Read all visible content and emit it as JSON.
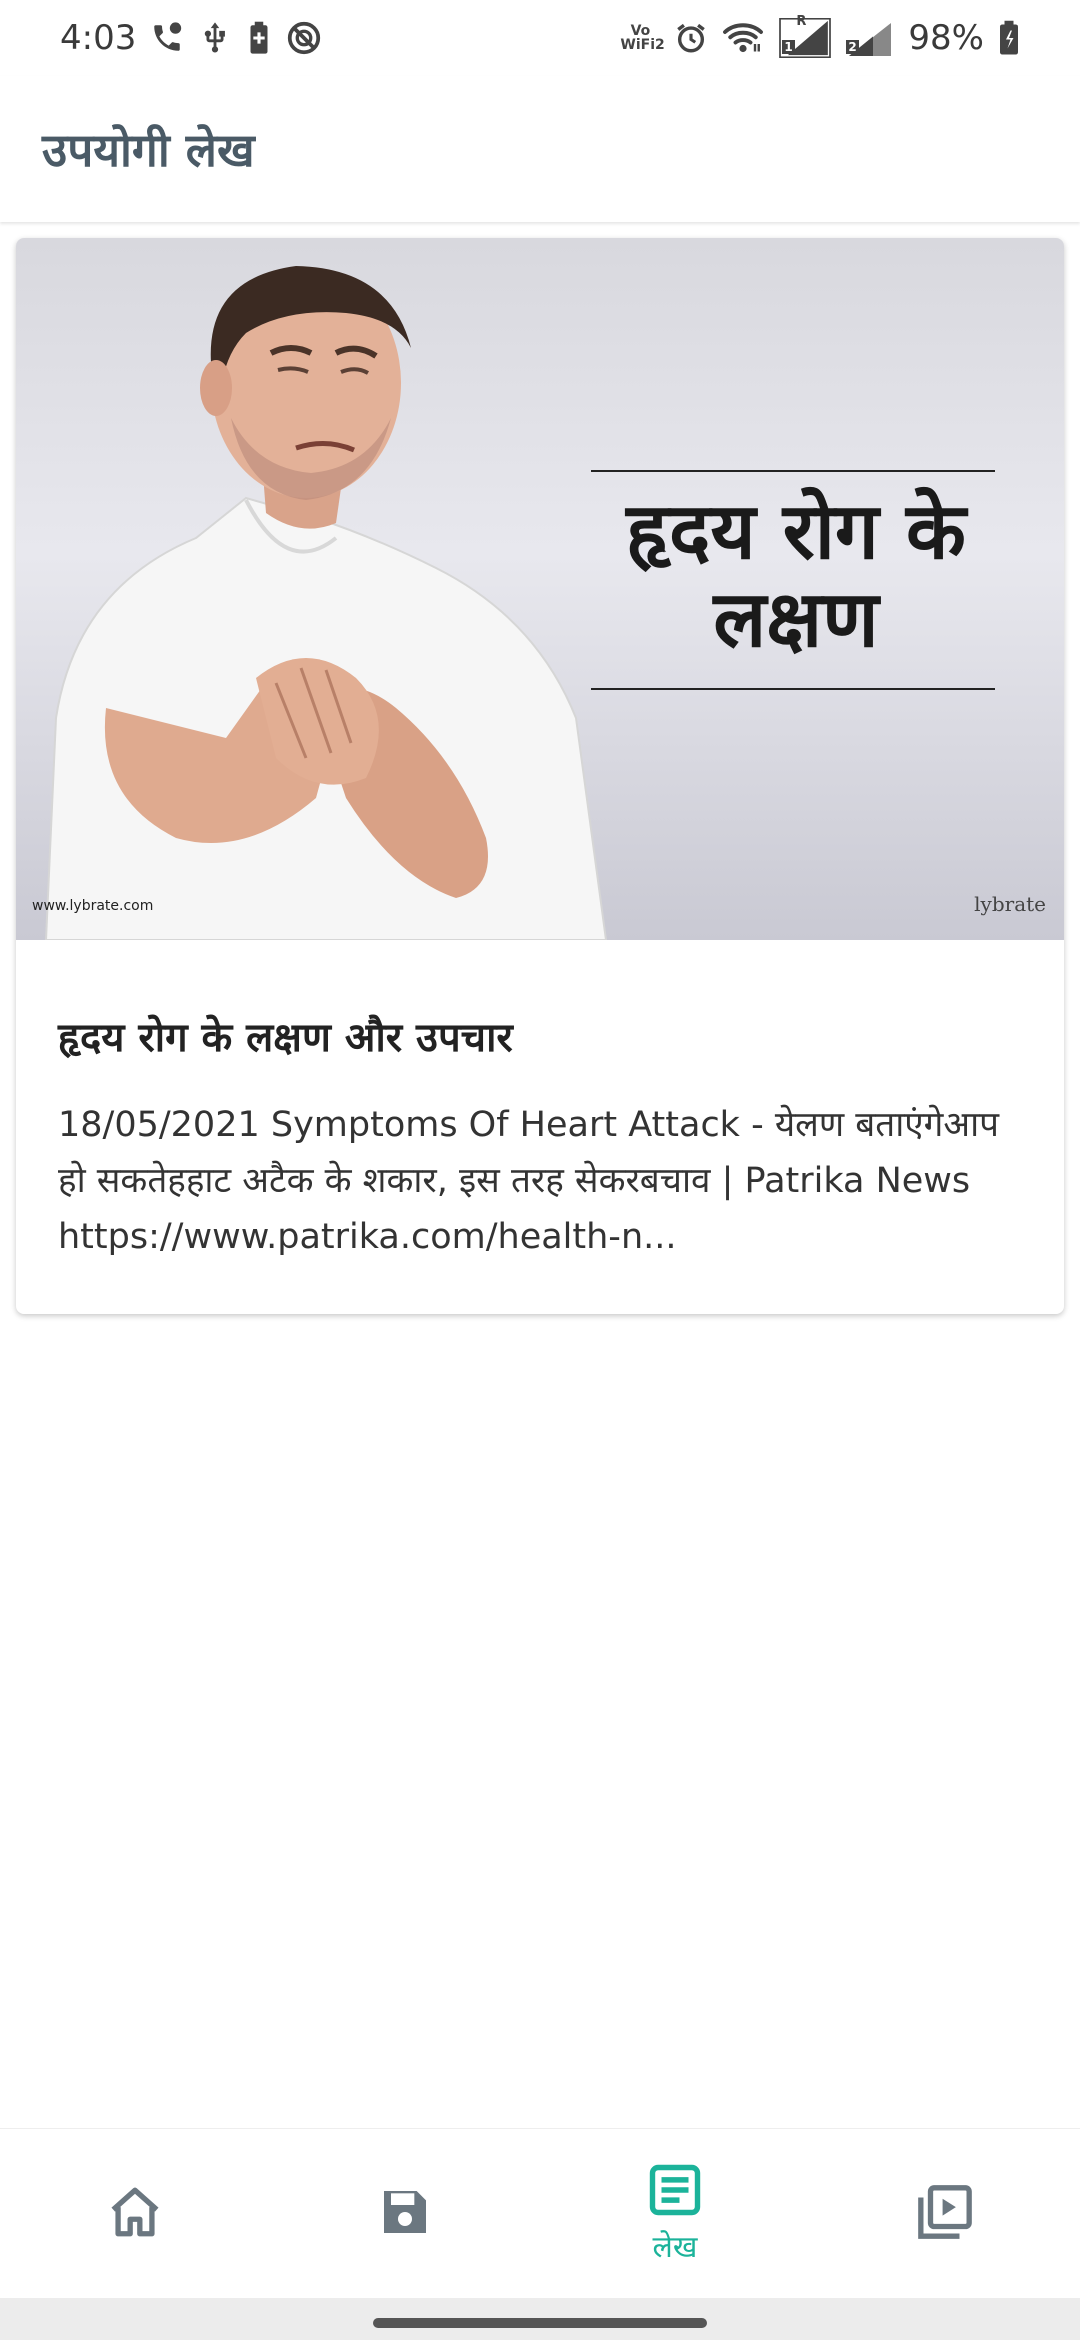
{
  "status_bar": {
    "time": "4:03",
    "battery_percent": "98%",
    "wifi_calling_label": "Vo WiFi2",
    "sim1_label": "1",
    "sim1_roaming": "R",
    "sim2_label": "2",
    "icons": [
      "phone-icon",
      "usb-icon",
      "battery-saver-icon",
      "do-not-disturb-icon",
      "wifi-calling-icon",
      "alarm-icon",
      "wifi-icon",
      "signal-icon",
      "battery-icon"
    ]
  },
  "header": {
    "title": "उपयोगी लेख"
  },
  "article": {
    "image_overlay_text": "हृदय रोग के लक्षण",
    "image_watermark_left": "www.lybrate.com",
    "image_watermark_right": "lybrate",
    "title": "हृदय रोग के लक्षण और उपचार",
    "snippet": "18/05/2021 Symptoms Of Heart Attack - येलण बताएंगेआप हो सकतेहहाट अटैक के शकार, इस तरह सेकरबचाव | Patrika News https://www.patrika.com/health-n..."
  },
  "bottom_nav": {
    "items": [
      {
        "icon": "home-icon",
        "label": "",
        "active": false
      },
      {
        "icon": "save-icon",
        "label": "",
        "active": false
      },
      {
        "icon": "article-icon",
        "label": "लेख",
        "active": true
      },
      {
        "icon": "video-library-icon",
        "label": "",
        "active": false
      }
    ],
    "active_color": "#1bb39a",
    "inactive_color": "#6b7780"
  }
}
